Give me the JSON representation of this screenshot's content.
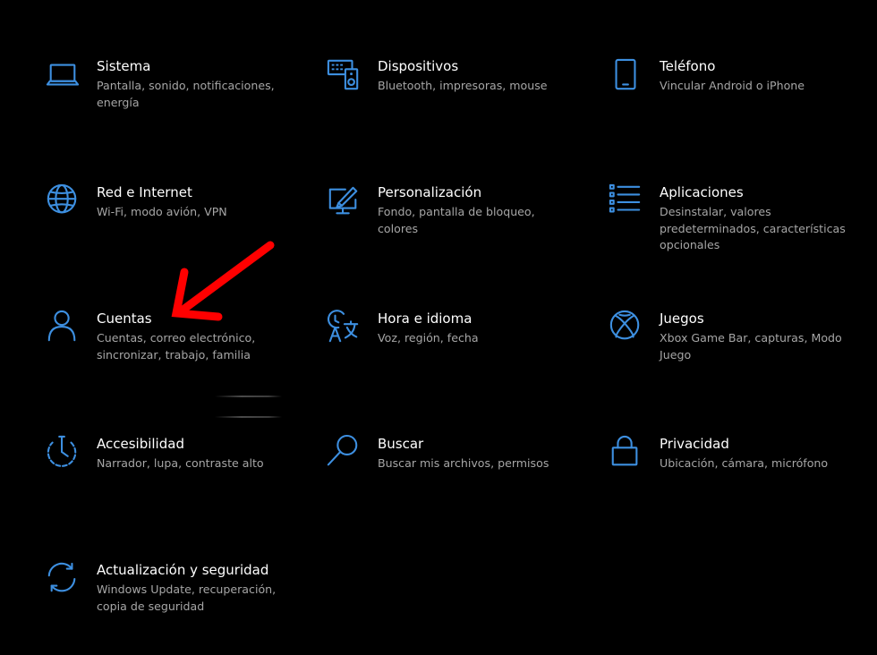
{
  "accent_color": "#3d8fe0",
  "annotation_color": "#ff0000",
  "tiles": [
    {
      "icon": "laptop-icon",
      "title": "Sistema",
      "desc": "Pantalla, sonido, notificaciones, energía"
    },
    {
      "icon": "keyboard-speaker-icon",
      "title": "Dispositivos",
      "desc": "Bluetooth, impresoras, mouse"
    },
    {
      "icon": "phone-icon",
      "title": "Teléfono",
      "desc": "Vincular Android o iPhone"
    },
    {
      "icon": "globe-icon",
      "title": "Red e Internet",
      "desc": "Wi-Fi, modo avión, VPN"
    },
    {
      "icon": "paint-screen-icon",
      "title": "Personalización",
      "desc": "Fondo, pantalla de bloqueo, colores"
    },
    {
      "icon": "app-list-icon",
      "title": "Aplicaciones",
      "desc": "Desinstalar, valores predeterminados, características opcionales"
    },
    {
      "icon": "person-icon",
      "title": "Cuentas",
      "desc": "Cuentas, correo electrónico, sincronizar, trabajo, familia"
    },
    {
      "icon": "time-language-icon",
      "title": "Hora e idioma",
      "desc": "Voz, región, fecha"
    },
    {
      "icon": "xbox-icon",
      "title": "Juegos",
      "desc": "Xbox Game Bar, capturas, Modo Juego"
    },
    {
      "icon": "accessibility-timer-icon",
      "title": "Accesibilidad",
      "desc": "Narrador, lupa, contraste alto"
    },
    {
      "icon": "search-icon",
      "title": "Buscar",
      "desc": "Buscar mis archivos, permisos"
    },
    {
      "icon": "lock-icon",
      "title": "Privacidad",
      "desc": "Ubicación, cámara, micrófono"
    },
    {
      "icon": "sync-icon",
      "title": "Actualización y seguridad",
      "desc": "Windows Update, recuperación, copia de seguridad"
    }
  ]
}
